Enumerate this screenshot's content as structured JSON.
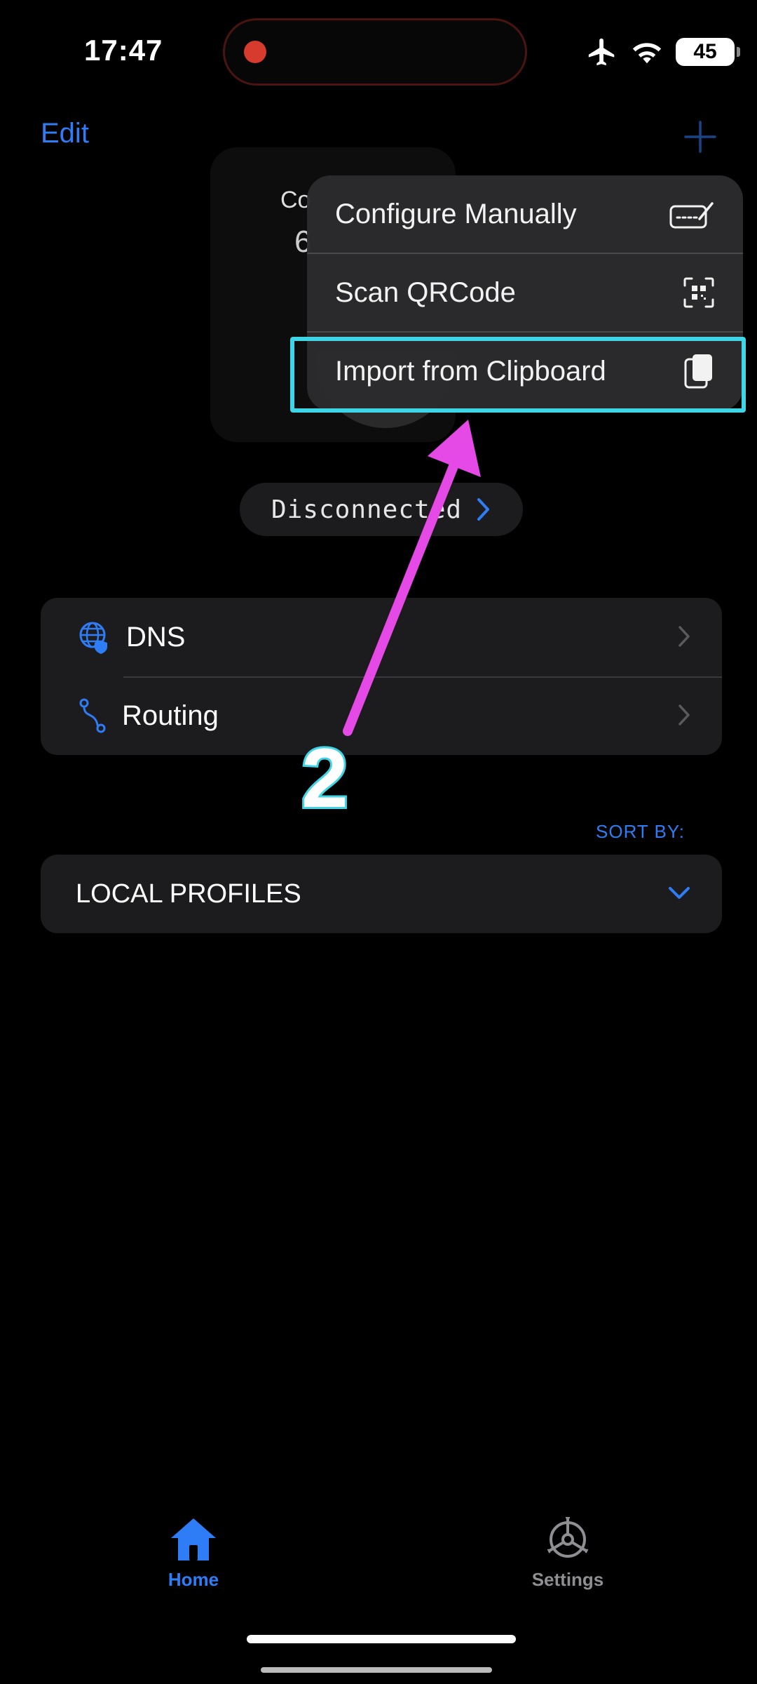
{
  "status_bar": {
    "time": "17:47",
    "battery": "45",
    "icons": [
      "airplane-icon",
      "wifi-icon",
      "battery-icon"
    ],
    "recording_color": "#d63b2d"
  },
  "nav": {
    "edit_label": "Edit",
    "add_icon": "plus-icon"
  },
  "background": {
    "connect_text": "Co",
    "connect_value": "6"
  },
  "connection": {
    "status": "Disconnected"
  },
  "menu": {
    "items": [
      {
        "label": "Configure Manually",
        "icon": "keyboard-pencil-icon"
      },
      {
        "label": "Scan QRCode",
        "icon": "qrcode-scan-icon"
      },
      {
        "label": "Import from Clipboard",
        "icon": "clipboard-icon"
      }
    ]
  },
  "settings_group": {
    "items": [
      {
        "label": "DNS",
        "icon": "globe-shield-icon"
      },
      {
        "label": "Routing",
        "icon": "route-icon"
      }
    ]
  },
  "sort_by_label": "SORT BY:",
  "profiles": {
    "label": "LOCAL PROFILES"
  },
  "annotation": {
    "step": "2",
    "highlight_color": "#3ed6e6",
    "arrow_color": "#e64ae6"
  },
  "tabs": [
    {
      "label": "Home",
      "icon": "home-icon",
      "active": true
    },
    {
      "label": "Settings",
      "icon": "gear-icon",
      "active": false
    }
  ],
  "colors": {
    "accent": "#2f7df6",
    "background": "#000000",
    "card": "#1c1c1e"
  }
}
